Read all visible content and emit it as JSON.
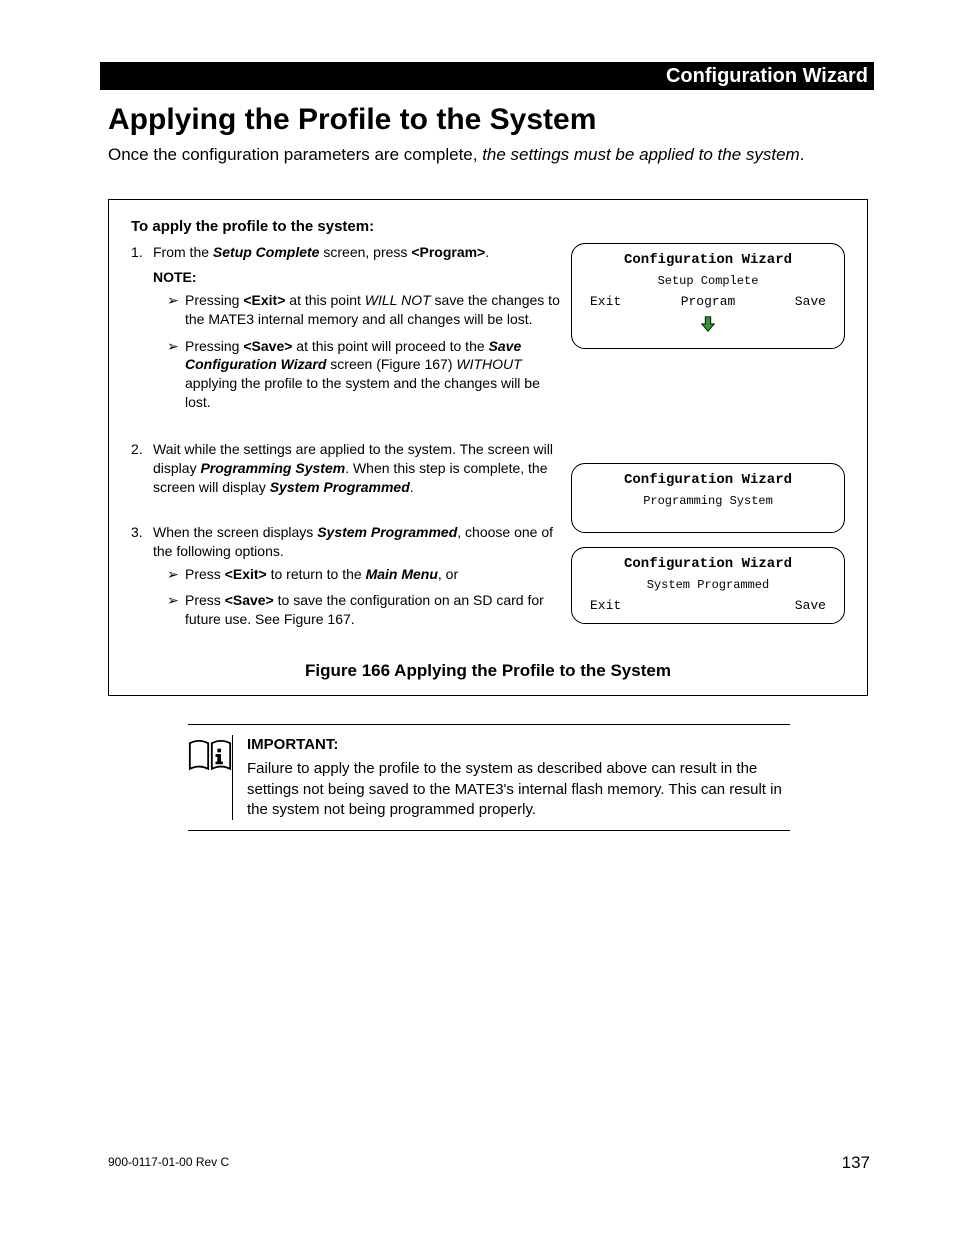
{
  "header": {
    "section": "Configuration Wizard"
  },
  "title": "Applying the Profile to the System",
  "intro": {
    "plain": "Once the configuration parameters are complete, ",
    "italic": "the settings must be applied to the system",
    "tail": "."
  },
  "instructions": {
    "heading": "To apply the profile to the system:",
    "step1": {
      "num": "1.",
      "pre": "From the ",
      "bi1": "Setup Complete",
      "mid": " screen, press ",
      "b1": "<Program>",
      "tail": "."
    },
    "note_label": "NOTE:",
    "note1": {
      "pre": "Pressing ",
      "b1": "<Exit>",
      "mid1": " at this point ",
      "i1": "WILL NOT",
      "tail": " save the changes to the MATE3 internal memory and all changes will be lost."
    },
    "note2": {
      "pre": "Pressing ",
      "b1": "<Save>",
      "mid1": " at this point will proceed to the ",
      "bi1": "Save Configuration Wizard",
      "mid2": " screen (Figure 167) ",
      "i1": "WITHOUT",
      "tail": " applying the profile to the system and the changes will be lost."
    },
    "step2": {
      "num": "2.",
      "pre": "Wait while the settings are applied to the system.  The screen will display ",
      "bi1": "Programming System",
      "mid": ".  When this step is complete, the screen will display ",
      "bi2": "System Programmed",
      "tail": "."
    },
    "step3": {
      "num": "3.",
      "pre": "When the screen displays ",
      "bi1": "System Programmed",
      "tail": ", choose one of the following options."
    },
    "opt1": {
      "pre": "Press ",
      "b1": "<Exit>",
      "mid": " to return to the ",
      "bi1": "Main Menu",
      "tail": ", or"
    },
    "opt2": {
      "pre": "Press ",
      "b1": "<Save>",
      "tail": " to save the configuration on an SD card for future use.  See Figure 167."
    }
  },
  "screens": {
    "s1": {
      "title": "Configuration Wizard",
      "sub": "Setup Complete",
      "btn_left": "Exit",
      "btn_mid": "Program",
      "btn_right": "Save"
    },
    "s2": {
      "title": "Configuration Wizard",
      "sub": "Programming System"
    },
    "s3": {
      "title": "Configuration Wizard",
      "sub": "System Programmed",
      "btn_left": "Exit",
      "btn_right": "Save"
    }
  },
  "figure_caption": "Figure 166    Applying the Profile to the System",
  "important": {
    "label": "IMPORTANT:",
    "body": "Failure to apply the profile to the system as described above can result in the settings not being saved to the MATE3's internal flash memory.  This can result in the system not being programmed properly."
  },
  "footer": {
    "left": "900-0117-01-00 Rev C",
    "page": "137"
  }
}
